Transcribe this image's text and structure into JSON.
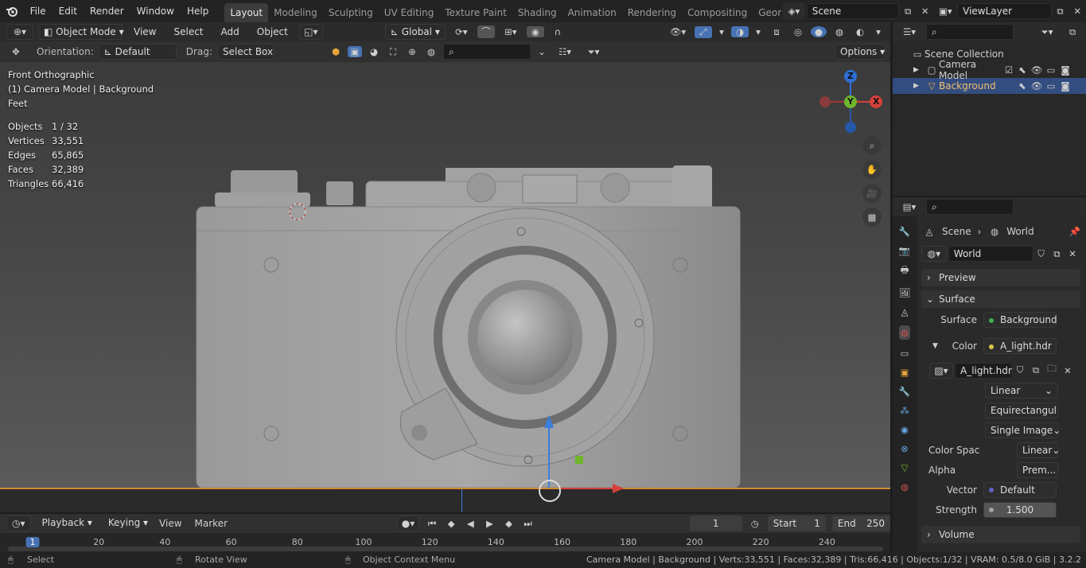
{
  "menu": {
    "items": [
      "File",
      "Edit",
      "Render",
      "Window",
      "Help"
    ]
  },
  "workspaces": [
    "Layout",
    "Modeling",
    "Sculpting",
    "UV Editing",
    "Texture Paint",
    "Shading",
    "Animation",
    "Rendering",
    "Compositing",
    "Geometry Noc"
  ],
  "scene_name": "Scene",
  "view_layer": "ViewLayer",
  "header": {
    "mode": "Object Mode",
    "view": "View",
    "select": "Select",
    "add": "Add",
    "object": "Object",
    "transform": "Global"
  },
  "tool_header": {
    "orientation_label": "Orientation:",
    "orientation": "Default",
    "drag_label": "Drag:",
    "drag": "Select Box",
    "options": "Options"
  },
  "viewport": {
    "title": "Front Orthographic",
    "subtitle": "(1) Camera Model | Background",
    "units": "Feet",
    "stats": [
      {
        "k": "Objects",
        "v": "1 / 32"
      },
      {
        "k": "Vertices",
        "v": "33,551"
      },
      {
        "k": "Edges",
        "v": "65,865"
      },
      {
        "k": "Faces",
        "v": "32,389"
      },
      {
        "k": "Triangles",
        "v": "66,416"
      }
    ],
    "gizmo": {
      "z": "Z",
      "y": "Y",
      "x": "X"
    }
  },
  "timeline": {
    "playback": "Playback",
    "keying": "Keying",
    "view": "View",
    "marker": "Marker",
    "current_frame": "1",
    "start_label": "Start",
    "start": "1",
    "end_label": "End",
    "end": "250",
    "ruler": [
      "1",
      "20",
      "40",
      "60",
      "80",
      "100",
      "120",
      "140",
      "160",
      "180",
      "200",
      "220",
      "240"
    ]
  },
  "outliner": {
    "root": "Scene Collection",
    "items": [
      {
        "name": "Camera Model",
        "selected": false
      },
      {
        "name": "Background",
        "selected": true
      }
    ]
  },
  "properties": {
    "breadcrumb_scene": "Scene",
    "breadcrumb_world": "World",
    "world_name": "World",
    "preview": "Preview",
    "surface_panel": "Surface",
    "surface_label": "Surface",
    "surface_value": "Background",
    "color_label": "Color",
    "color_value": "A_light.hdr",
    "image_name": "A_light.hdr",
    "interpolation": "Linear",
    "projection": "Equirectangul",
    "source": "Single Image",
    "colorspace_label": "Color Spac",
    "colorspace": "Linear",
    "alpha_label": "Alpha",
    "alpha": "Prem...",
    "vector_label": "Vector",
    "vector": "Default",
    "strength_label": "Strength",
    "strength": "1.500",
    "volume": "Volume"
  },
  "status": {
    "select": "Select",
    "rotate": "Rotate View",
    "context": "Object Context Menu",
    "info": "Camera Model | Background | Verts:33,551 | Faces:32,389 | Tris:66,416 | Objects:1/32 | VRAM: 0.5/8.0 GiB | 3.2.2"
  },
  "colors": {
    "accent": "#4772b3",
    "selected_row": "#334d80",
    "axis_x": "#d8413a",
    "axis_y": "#6fb52d",
    "axis_z": "#2f6fd6",
    "timeline_line": "#d48a2f"
  }
}
